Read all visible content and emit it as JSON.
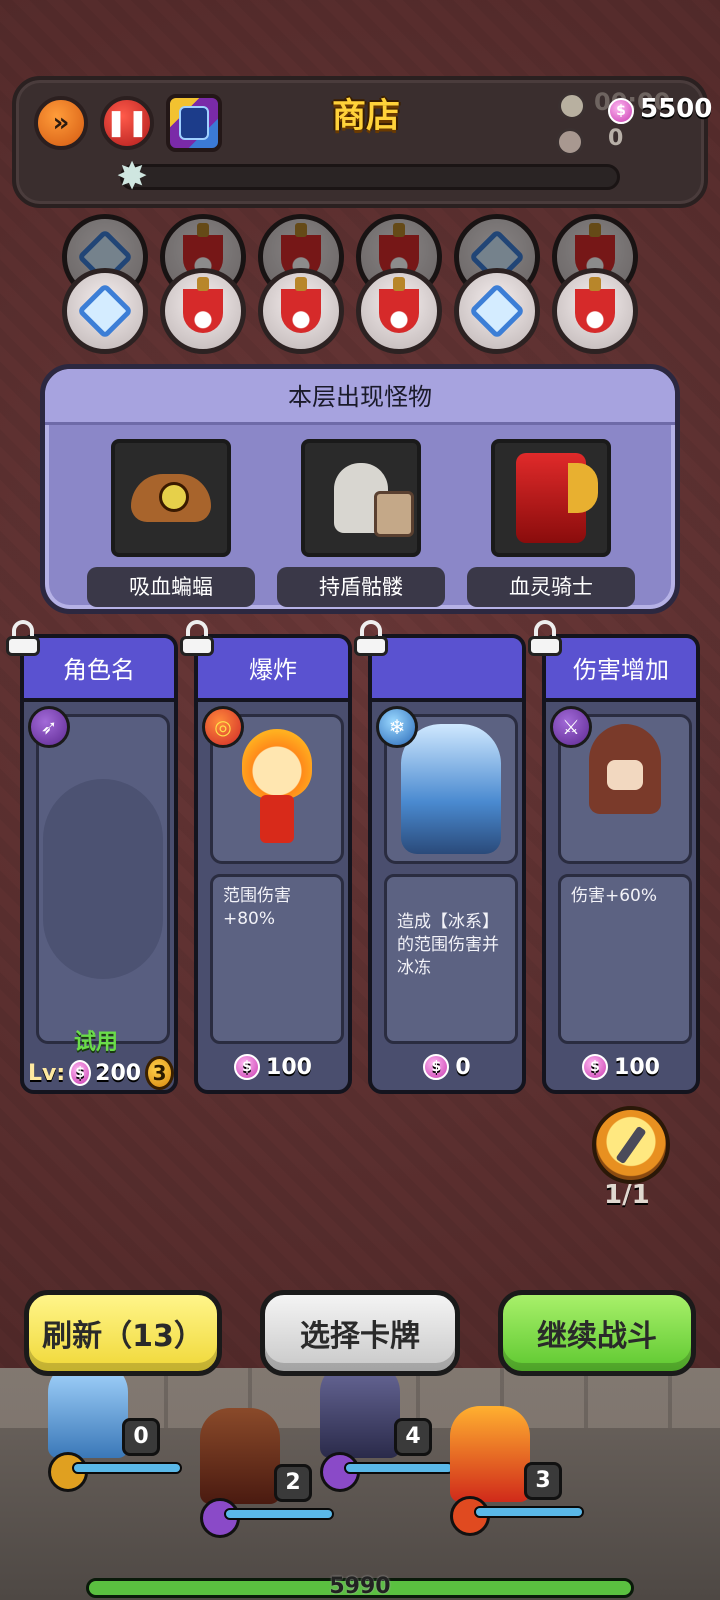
{
  "topbar": {
    "title": "商店",
    "timer": "00:00",
    "coins": "5500",
    "kills": "0",
    "wave_progress": 0.0
  },
  "wave_nodes": {
    "back": [
      "clock",
      "sword",
      "sword",
      "sword",
      "clock",
      "sword"
    ],
    "front": [
      "clock",
      "sword",
      "sword",
      "sword",
      "clock",
      "sword"
    ]
  },
  "monster_panel": {
    "header": "本层出现怪物",
    "monsters": [
      {
        "name": "吸血蝙蝠",
        "icon": "bat-icon"
      },
      {
        "name": "持盾骷髅",
        "icon": "skeleton-icon"
      },
      {
        "name": "血灵骑士",
        "icon": "knight-icon"
      }
    ]
  },
  "cards": [
    {
      "title": "角色名",
      "badge": "arrow",
      "empty": true,
      "trial": "试用",
      "lv_label": "Lv:",
      "price": "200",
      "level": "3"
    },
    {
      "title": "爆炸",
      "badge": "fire",
      "desc": "范围伤害+80%",
      "price": "100"
    },
    {
      "title": "",
      "badge": "ice",
      "desc": "造成【冰系】的范围伤害并冰冻",
      "price": "0"
    },
    {
      "title": "伤害增加",
      "badge": "staff",
      "desc": "伤害+60%",
      "price": "100"
    }
  ],
  "weapon_slot": {
    "count": "1/1"
  },
  "buttons": {
    "refresh": "刷新（13）",
    "choose": "选择卡牌",
    "continue": "继续战斗"
  },
  "battle": {
    "units": [
      {
        "level": "0"
      },
      {
        "level": "2"
      },
      {
        "level": "4"
      },
      {
        "level": "3"
      }
    ],
    "total_hp": "5990"
  },
  "colors": {
    "accent_purple": "#5a52d0",
    "coin_pink": "#c83bb0",
    "refresh_yellow": "#f0d838",
    "continue_green": "#5ec830"
  }
}
